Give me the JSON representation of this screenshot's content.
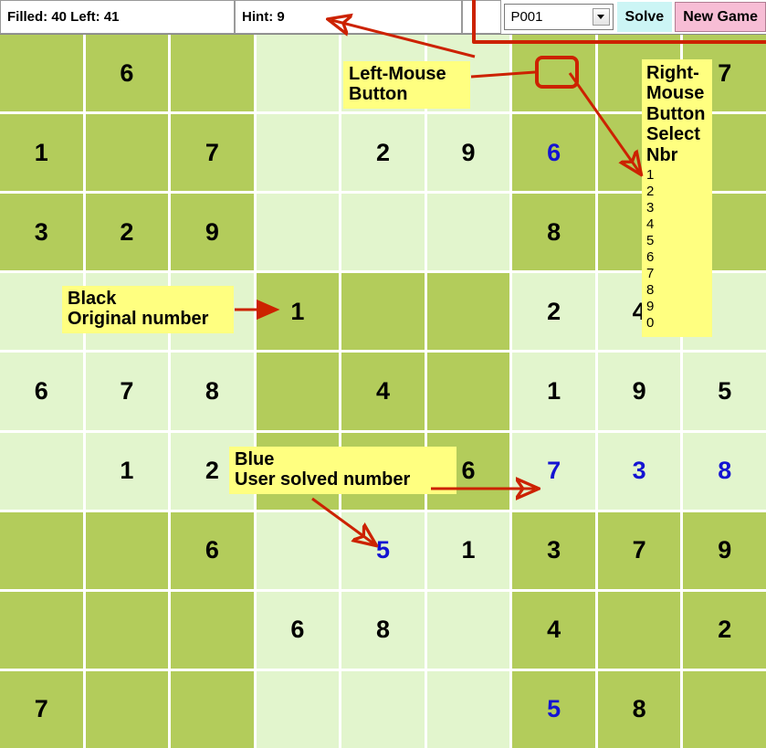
{
  "toolbar": {
    "status_text": "Filled: 40 Left: 41",
    "hint_text": "Hint: 9",
    "spacer_text": "",
    "puzzle_select_value": "P001",
    "solve_label": "Solve",
    "new_game_label": "New Game",
    "solve_bg": "#ccf5f5",
    "new_game_bg": "#f7bdd5"
  },
  "colors": {
    "cell_dark": "#b3cc5b",
    "cell_light": "#e2f5cd",
    "original_number": "#000000",
    "user_number": "#1414d2",
    "note_bg": "#ffff80",
    "annotation_red": "#cc2200"
  },
  "annotations": {
    "left_mouse": "Left-Mouse Button",
    "black": "Black\nOriginal number",
    "black_line1": "Black",
    "black_line2": "Original number",
    "blue_line1": "Blue",
    "blue_line2": "User solved number",
    "right_mouse_title": "Right-Mouse Button Select Nbr",
    "right_mouse_numbers": [
      "1",
      "2",
      "3",
      "4",
      "5",
      "6",
      "7",
      "8",
      "9",
      "0"
    ]
  },
  "grid": {
    "rows": 9,
    "cols": 9,
    "cells": [
      [
        {
          "v": "",
          "t": "o"
        },
        {
          "v": "6",
          "t": "o"
        },
        {
          "v": "",
          "t": "o"
        },
        {
          "v": "",
          "t": "o"
        },
        {
          "v": "",
          "t": "o"
        },
        {
          "v": "",
          "t": "o"
        },
        {
          "v": "",
          "t": "o"
        },
        {
          "v": "",
          "t": "o"
        },
        {
          "v": "7",
          "t": "o"
        }
      ],
      [
        {
          "v": "1",
          "t": "o"
        },
        {
          "v": "",
          "t": "o"
        },
        {
          "v": "7",
          "t": "o"
        },
        {
          "v": "",
          "t": "o"
        },
        {
          "v": "2",
          "t": "o"
        },
        {
          "v": "9",
          "t": "o"
        },
        {
          "v": "6",
          "t": "u"
        },
        {
          "v": "",
          "t": "o"
        },
        {
          "v": "",
          "t": "o"
        }
      ],
      [
        {
          "v": "3",
          "t": "o"
        },
        {
          "v": "2",
          "t": "o"
        },
        {
          "v": "9",
          "t": "o"
        },
        {
          "v": "",
          "t": "o"
        },
        {
          "v": "",
          "t": "o"
        },
        {
          "v": "",
          "t": "o"
        },
        {
          "v": "8",
          "t": "o"
        },
        {
          "v": "",
          "t": "o"
        },
        {
          "v": "",
          "t": "o"
        }
      ],
      [
        {
          "v": "",
          "t": "o"
        },
        {
          "v": "",
          "t": "o"
        },
        {
          "v": "",
          "t": "o"
        },
        {
          "v": "1",
          "t": "o"
        },
        {
          "v": "",
          "t": "o"
        },
        {
          "v": "",
          "t": "o"
        },
        {
          "v": "2",
          "t": "o"
        },
        {
          "v": "4",
          "t": "o"
        },
        {
          "v": "",
          "t": "o"
        }
      ],
      [
        {
          "v": "6",
          "t": "o"
        },
        {
          "v": "7",
          "t": "o"
        },
        {
          "v": "8",
          "t": "o"
        },
        {
          "v": "",
          "t": "o"
        },
        {
          "v": "4",
          "t": "o"
        },
        {
          "v": "",
          "t": "o"
        },
        {
          "v": "1",
          "t": "o"
        },
        {
          "v": "9",
          "t": "o"
        },
        {
          "v": "5",
          "t": "o"
        }
      ],
      [
        {
          "v": "",
          "t": "o"
        },
        {
          "v": "1",
          "t": "o"
        },
        {
          "v": "2",
          "t": "o"
        },
        {
          "v": "",
          "t": "o"
        },
        {
          "v": "",
          "t": "o"
        },
        {
          "v": "6",
          "t": "o"
        },
        {
          "v": "7",
          "t": "u"
        },
        {
          "v": "3",
          "t": "u"
        },
        {
          "v": "8",
          "t": "u"
        }
      ],
      [
        {
          "v": "",
          "t": "o"
        },
        {
          "v": "",
          "t": "o"
        },
        {
          "v": "6",
          "t": "o"
        },
        {
          "v": "",
          "t": "o"
        },
        {
          "v": "5",
          "t": "u"
        },
        {
          "v": "1",
          "t": "o"
        },
        {
          "v": "3",
          "t": "o"
        },
        {
          "v": "7",
          "t": "o"
        },
        {
          "v": "9",
          "t": "o"
        }
      ],
      [
        {
          "v": "",
          "t": "o"
        },
        {
          "v": "",
          "t": "o"
        },
        {
          "v": "",
          "t": "o"
        },
        {
          "v": "6",
          "t": "o"
        },
        {
          "v": "8",
          "t": "o"
        },
        {
          "v": "",
          "t": "o"
        },
        {
          "v": "4",
          "t": "o"
        },
        {
          "v": "",
          "t": "o"
        },
        {
          "v": "2",
          "t": "o"
        }
      ],
      [
        {
          "v": "7",
          "t": "o"
        },
        {
          "v": "",
          "t": "o"
        },
        {
          "v": "",
          "t": "o"
        },
        {
          "v": "",
          "t": "o"
        },
        {
          "v": "",
          "t": "o"
        },
        {
          "v": "",
          "t": "o"
        },
        {
          "v": "5",
          "t": "u"
        },
        {
          "v": "8",
          "t": "o"
        },
        {
          "v": "",
          "t": "o"
        }
      ]
    ]
  }
}
